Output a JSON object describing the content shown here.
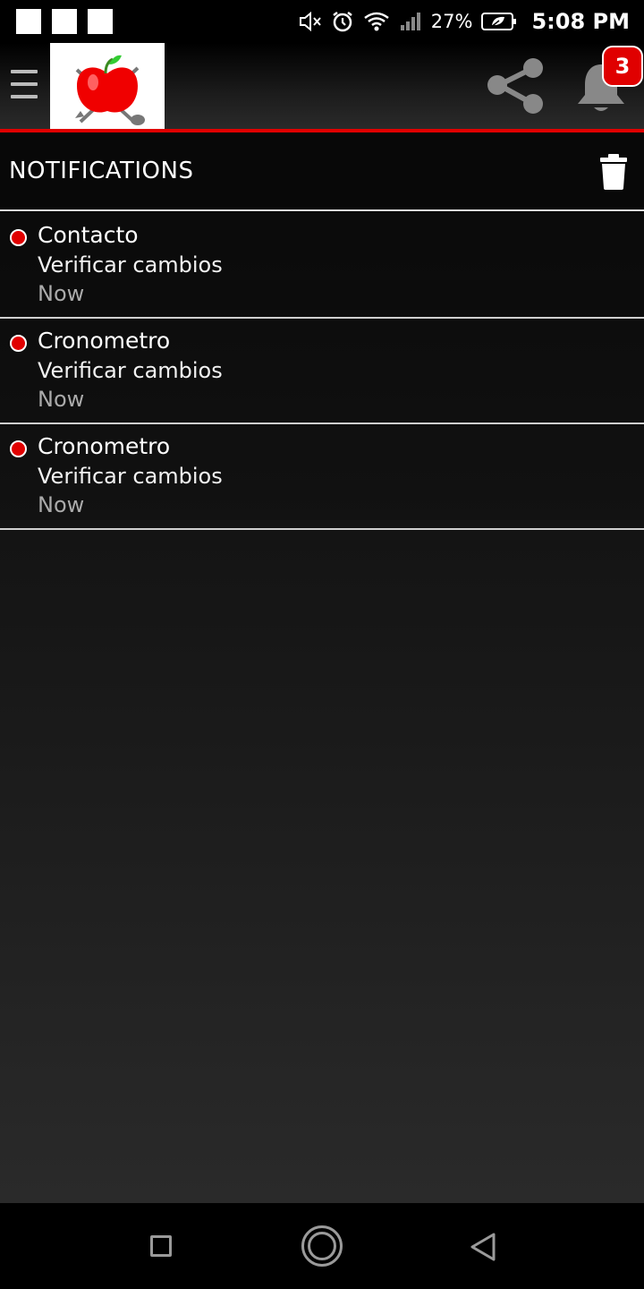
{
  "status_bar": {
    "battery_percent": "27%",
    "time": "5:08 PM",
    "icons": [
      "mute-icon",
      "alarm-icon",
      "wifi-icon",
      "signal-icon",
      "battery-saver-icon"
    ]
  },
  "app_bar": {
    "notification_count": "3",
    "accent_color": "#e00000"
  },
  "notifications": {
    "title": "NOTIFICATIONS",
    "items": [
      {
        "title": "Contacto",
        "body": "Verificar cambios",
        "time": "Now"
      },
      {
        "title": "Cronometro",
        "body": "Verificar cambios",
        "time": "Now"
      },
      {
        "title": "Cronometro",
        "body": "Verificar cambios",
        "time": "Now"
      }
    ]
  }
}
